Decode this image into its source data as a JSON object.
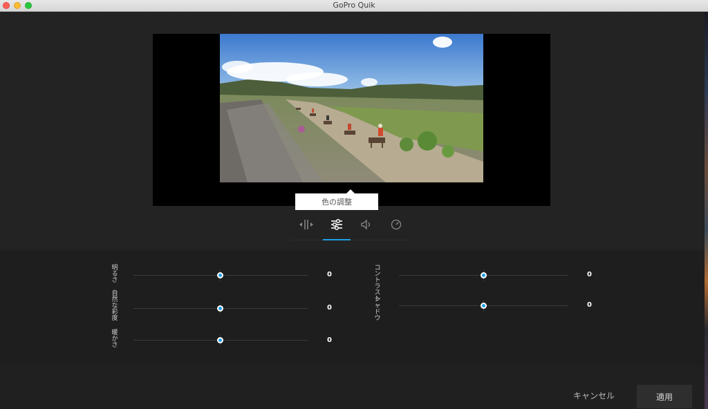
{
  "window": {
    "title": "GoPro Quik"
  },
  "tooltip": {
    "text": "色の調整"
  },
  "tabs": [
    {
      "icon": "trim-icon",
      "active": false
    },
    {
      "icon": "sliders-icon",
      "active": true
    },
    {
      "icon": "volume-icon",
      "active": false
    },
    {
      "icon": "speed-icon",
      "active": false
    }
  ],
  "adjustments": {
    "brightness": {
      "label": "明るさ",
      "value": "0"
    },
    "vibrance": {
      "label": "自然な彩度",
      "value": "0"
    },
    "warmth": {
      "label": "暖かさ",
      "value": "0"
    },
    "contrast": {
      "label": "コントラスト",
      "value": "0"
    },
    "shadows": {
      "label": "シャドウ",
      "value": "0"
    }
  },
  "footer": {
    "cancel_label": "キャンセル",
    "apply_label": "適用"
  },
  "colors": {
    "accent": "#1da1e6",
    "background": "#232323"
  }
}
